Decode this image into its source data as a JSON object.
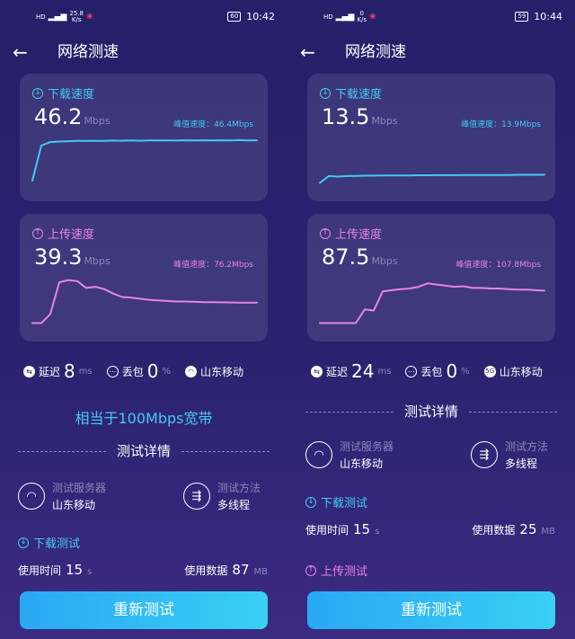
{
  "colors": {
    "download": "#43c9f2",
    "upload": "#e783e8",
    "button": "#2aa8f4"
  },
  "left": {
    "status": {
      "left_text": "HD",
      "speed": "25.8",
      "speed_unit": "K/s",
      "battery": "60",
      "time": "10:42"
    },
    "title": "网络测速",
    "download": {
      "label": "下载速度",
      "value": "46.2",
      "unit": "Mbps",
      "peak": "峰值速度：46.4Mbps",
      "series": [
        4,
        35,
        38,
        38.5,
        38.8,
        39,
        39,
        39.2,
        39,
        39.3,
        39.2,
        39.4,
        39.2,
        39.5,
        39.4,
        39.5,
        39.3,
        39.6,
        39.5,
        39.6,
        39.4,
        39.6,
        39.5,
        39.7,
        39.5,
        39.6
      ]
    },
    "upload": {
      "label": "上传速度",
      "value": "39.3",
      "unit": "Mbps",
      "peak": "峰值速度：76.2Mbps",
      "series": [
        2,
        2,
        10,
        38,
        40,
        39,
        33,
        34,
        32,
        28,
        25,
        24.5,
        23.5,
        22.5,
        22,
        21.5,
        21,
        21,
        20.8,
        20.5,
        20.5,
        20.3,
        20.2,
        20,
        20,
        20
      ]
    },
    "metrics": {
      "latency_label": "延迟",
      "latency_value": "8",
      "latency_unit": "ms",
      "loss_label": "丢包",
      "loss_value": "0",
      "loss_unit": "%",
      "carrier": "山东移动"
    },
    "equivalent": "相当于100Mbps宽带",
    "details_title": "测试详情",
    "server_label": "测试服务器",
    "server_value": "山东移动",
    "method_label": "测试方法",
    "method_value": "多线程",
    "download_test_label": "下载测试",
    "time_label": "使用时间",
    "time_value": "15",
    "time_unit": "s",
    "data_label": "使用数据",
    "data_value": "87",
    "data_unit": "MB",
    "retest": "重新测试"
  },
  "right": {
    "status": {
      "left_text": "HD",
      "speed": "0",
      "speed_unit": "K/s",
      "battery": "59",
      "time": "10:44"
    },
    "title": "网络测速",
    "download": {
      "label": "下载速度",
      "value": "13.5",
      "unit": "Mbps",
      "peak": "峰值速度：13.9Mbps",
      "series": [
        2,
        8,
        7.5,
        8,
        8.2,
        8.3,
        8.4,
        8.5,
        8.5,
        8.6,
        8.6,
        8.7,
        8.7,
        8.8,
        8.8,
        8.8,
        8.9,
        8.9,
        8.9,
        9,
        9,
        9,
        9.1,
        9.1,
        9.1,
        9.2
      ]
    },
    "upload": {
      "label": "上传速度",
      "value": "87.5",
      "unit": "Mbps",
      "peak": "峰值速度：107.8Mbps",
      "series": [
        2,
        2,
        2,
        2,
        2,
        14,
        13,
        30,
        31,
        32,
        32.5,
        34,
        37,
        36,
        35,
        34,
        34.5,
        33,
        33,
        32.5,
        32.5,
        32,
        31.5,
        31.5,
        31,
        30.5
      ]
    },
    "metrics": {
      "latency_label": "延迟",
      "latency_value": "24",
      "latency_unit": "ms",
      "loss_label": "丢包",
      "loss_value": "0",
      "loss_unit": "%",
      "carrier": "山东移动",
      "network_badge": "5G"
    },
    "details_title": "测试详情",
    "server_label": "测试服务器",
    "server_value": "山东移动",
    "method_label": "测试方法",
    "method_value": "多线程",
    "download_test_label": "下载测试",
    "time_label": "使用时间",
    "time_value": "15",
    "time_unit": "s",
    "data_label": "使用数据",
    "data_value": "25",
    "data_unit": "MB",
    "upload_test_label": "上传测试",
    "retest": "重新测试"
  }
}
